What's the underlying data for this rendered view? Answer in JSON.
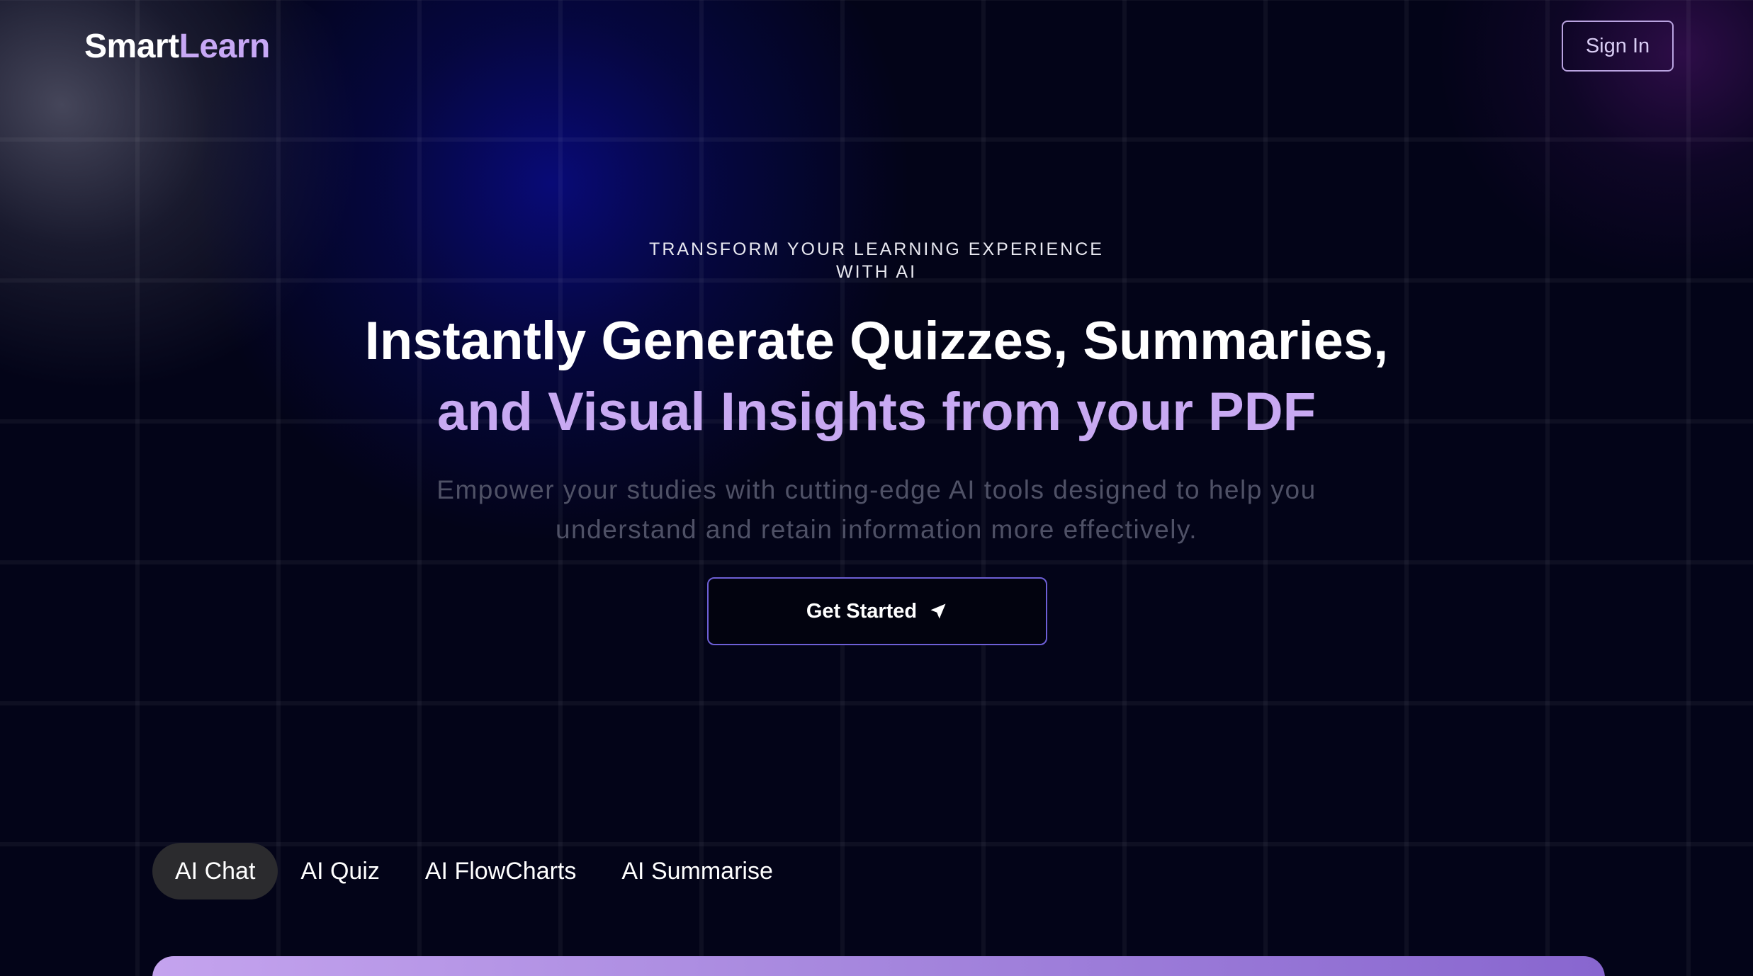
{
  "header": {
    "logo_part1": "Smart",
    "logo_part2": "Learn",
    "signin_label": "Sign In"
  },
  "hero": {
    "eyebrow_line1": "TRANSFORM YOUR LEARNING EXPERIENCE",
    "eyebrow_line2": "WITH AI",
    "headline_line1": "Instantly Generate Quizzes, Summaries,",
    "headline_line2": "and Visual Insights from your PDF",
    "subtext_line1": "Empower your studies with cutting-edge AI tools designed to help you",
    "subtext_line2": "understand and retain information more effectively.",
    "cta_label": "Get Started",
    "cta_icon": "send-arrow-icon"
  },
  "tabs": [
    {
      "label": "AI Chat",
      "active": true
    },
    {
      "label": "AI Quiz",
      "active": false
    },
    {
      "label": "AI FlowCharts",
      "active": false
    },
    {
      "label": "AI Summarise",
      "active": false
    }
  ],
  "colors": {
    "background": "#030418",
    "accent_lavender": "#c8a9f2",
    "cta_border": "#6d5fd6",
    "tab_active_bg": "#2b2b2e"
  }
}
